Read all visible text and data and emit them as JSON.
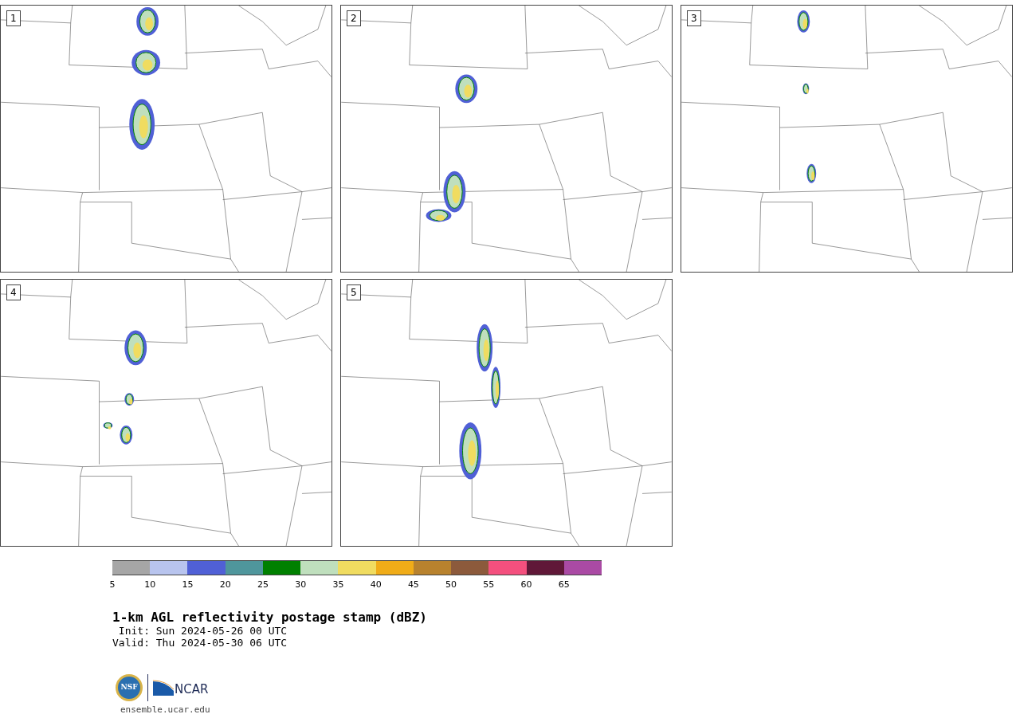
{
  "panels": [
    {
      "label": "1"
    },
    {
      "label": "2"
    },
    {
      "label": "3"
    },
    {
      "label": "4"
    },
    {
      "label": "5"
    }
  ],
  "colorbar": {
    "bins": [
      {
        "color": "#a6a6a6",
        "label": "5"
      },
      {
        "color": "#b8c4ee",
        "label": "10"
      },
      {
        "color": "#5060d6",
        "label": "15"
      },
      {
        "color": "#4f969c",
        "label": "20"
      },
      {
        "color": "#008000",
        "label": "25"
      },
      {
        "color": "#bfdfbd",
        "label": "30"
      },
      {
        "color": "#f0dc60",
        "label": "35"
      },
      {
        "color": "#f0ac18",
        "label": "40"
      },
      {
        "color": "#b8822e",
        "label": "45"
      },
      {
        "color": "#8c5a3c",
        "label": "50"
      },
      {
        "color": "#f4507e",
        "label": "55"
      },
      {
        "color": "#601838",
        "label": "60"
      },
      {
        "color": "#aa4aa4",
        "label": "65"
      }
    ]
  },
  "title": "1-km AGL reflectivity postage stamp (dBZ)",
  "init": " Init: Sun 2024-05-26 00 UTC",
  "valid": "Valid: Thu 2024-05-30 06 UTC",
  "logos": {
    "nsf": "NSF",
    "ncar": "NCAR"
  },
  "url": "ensemble.ucar.edu"
}
